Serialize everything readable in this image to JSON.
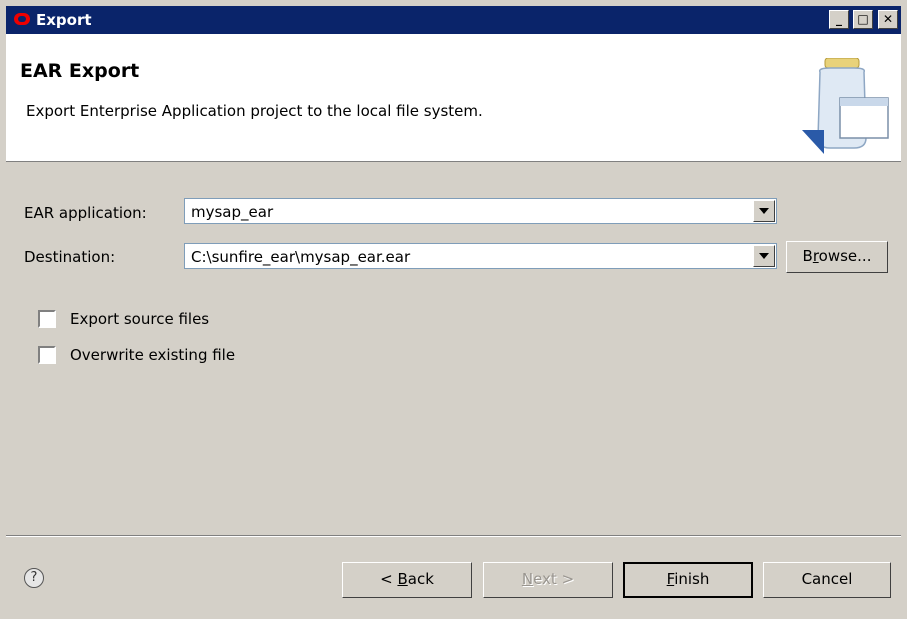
{
  "window": {
    "title": "Export"
  },
  "header": {
    "title": "EAR Export",
    "description": "Export Enterprise Application project to the local file system."
  },
  "form": {
    "ear_label": "EAR application:",
    "ear_value": "mysap_ear",
    "dest_label": "Destination:",
    "dest_value": "C:\\sunfire_ear\\mysap_ear.ear",
    "browse_label_pre": "B",
    "browse_label_u": "r",
    "browse_label_post": "owse...",
    "opt_source_label": "Export source files",
    "opt_overwrite_label": "Overwrite existing file"
  },
  "footer": {
    "back_pre": "< ",
    "back_u": "B",
    "back_post": "ack",
    "next_u": "N",
    "next_post": "ext >",
    "finish_u": "F",
    "finish_post": "inish",
    "cancel": "Cancel",
    "help_glyph": "?"
  }
}
